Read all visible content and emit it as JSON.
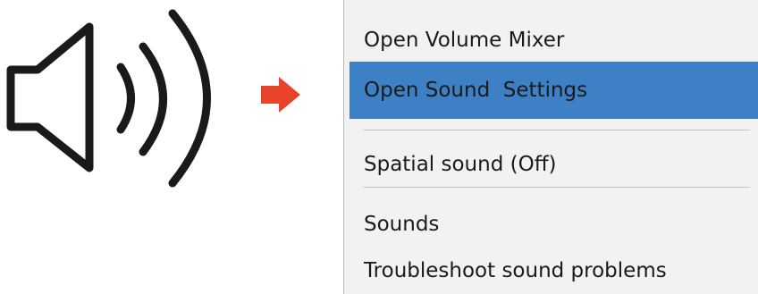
{
  "icons": {
    "speaker": "speaker-volume-icon",
    "arrow": "right-arrow-icon"
  },
  "colors": {
    "highlight": "#3d80c6",
    "arrow": "#e8442c",
    "menu_background": "#f2f2f2",
    "icon_stroke": "#1a1a1a"
  },
  "menu": {
    "items": [
      {
        "label": "Open Volume Mixer"
      },
      {
        "label": "Open Sound  Settings",
        "highlighted": true
      },
      {
        "label": "Spatial sound (Off)"
      },
      {
        "label": "Sounds"
      },
      {
        "label": "Troubleshoot sound problems"
      }
    ]
  }
}
